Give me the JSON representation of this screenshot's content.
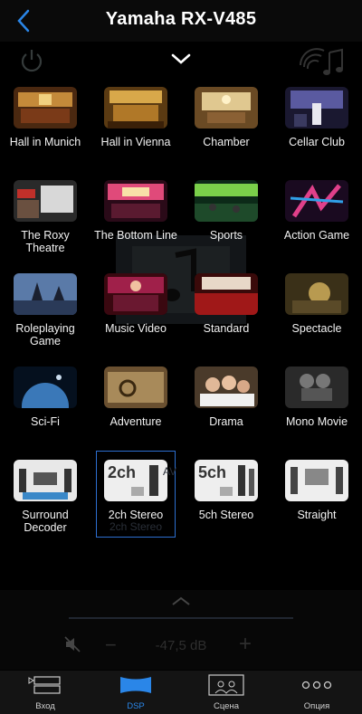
{
  "header": {
    "title": "Yamaha RX-V485"
  },
  "icons": {
    "back": "chevron-left-icon",
    "power": "power-icon",
    "collapse": "chevron-down-icon",
    "music": "music-note-icon"
  },
  "colors": {
    "accent": "#2a86e8",
    "selection_border": "#2d6fd0",
    "background": "#000000"
  },
  "programs": [
    {
      "label": "Hall in Munich"
    },
    {
      "label": "Hall in Vienna"
    },
    {
      "label": "Chamber"
    },
    {
      "label": "Cellar Club"
    },
    {
      "label": "The Roxy Theatre"
    },
    {
      "label": "The Bottom Line"
    },
    {
      "label": "Sports"
    },
    {
      "label": "Action Game"
    },
    {
      "label": "Roleplaying Game"
    },
    {
      "label": "Music Video"
    },
    {
      "label": "Standard"
    },
    {
      "label": "Spectacle"
    },
    {
      "label": "Sci-Fi"
    },
    {
      "label": "Adventure"
    },
    {
      "label": "Drama"
    },
    {
      "label": "Mono Movie"
    },
    {
      "label": "Surround Decoder"
    },
    {
      "label": "2ch Stereo",
      "thumb_text": "2ch",
      "selected": true
    },
    {
      "label": "5ch Stereo",
      "thumb_text": "5ch"
    },
    {
      "label": "Straight"
    }
  ],
  "selected_program": "2ch Stereo",
  "volume": {
    "value": "-47,5 dB",
    "minus": "−",
    "plus": "+"
  },
  "background_ghost": {
    "label": "2ch Stereo",
    "tag": "AV"
  },
  "tabs": [
    {
      "label": "Вход",
      "icon": "input-icon"
    },
    {
      "label": "DSP",
      "icon": "dsp-icon",
      "active": true
    },
    {
      "label": "Сцена",
      "icon": "scene-icon"
    },
    {
      "label": "Опция",
      "icon": "more-options-icon"
    }
  ]
}
